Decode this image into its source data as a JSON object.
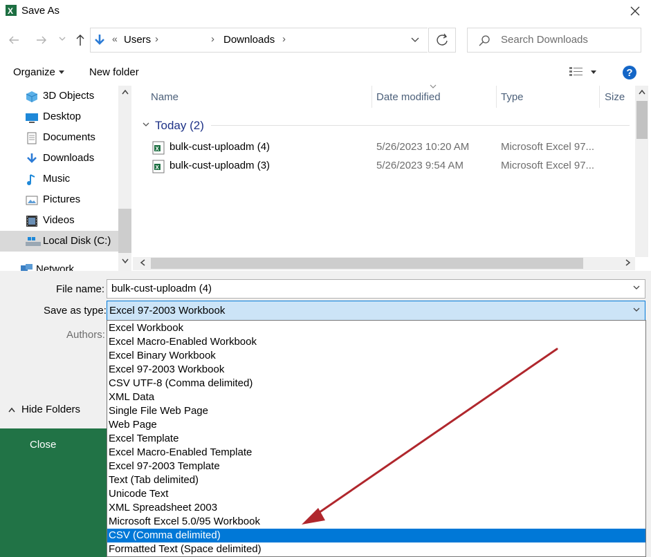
{
  "window": {
    "title": "Save As",
    "app_icon": "excel-icon"
  },
  "address": {
    "overflow": "«",
    "crumbs": [
      "Users",
      "Downloads"
    ],
    "search_placeholder": "Search Downloads"
  },
  "toolbar": {
    "organize": "Organize",
    "new_folder": "New folder",
    "help": "?"
  },
  "nav": {
    "items": [
      {
        "label": "3D Objects",
        "icon": "cube-icon"
      },
      {
        "label": "Desktop",
        "icon": "desktop-icon"
      },
      {
        "label": "Documents",
        "icon": "documents-icon"
      },
      {
        "label": "Downloads",
        "icon": "download-icon"
      },
      {
        "label": "Music",
        "icon": "music-icon"
      },
      {
        "label": "Pictures",
        "icon": "pictures-icon"
      },
      {
        "label": "Videos",
        "icon": "videos-icon"
      },
      {
        "label": "Local Disk (C:)",
        "icon": "drive-icon"
      },
      {
        "label": "Network",
        "icon": "network-icon"
      }
    ],
    "selected": "Local Disk (C:)"
  },
  "files": {
    "columns": [
      "Name",
      "Date modified",
      "Type",
      "Size"
    ],
    "group": "Today (2)",
    "rows": [
      {
        "name": "bulk-cust-uploadm (4)",
        "date": "5/26/2023 10:20 AM",
        "type": "Microsoft Excel 97..."
      },
      {
        "name": "bulk-cust-uploadm (3)",
        "date": "5/26/2023 9:54 AM",
        "type": "Microsoft Excel 97..."
      }
    ]
  },
  "form": {
    "file_name_label": "File name:",
    "file_name_value": "bulk-cust-uploadm (4)",
    "save_type_label": "Save as type:",
    "save_type_value": "Excel 97-2003 Workbook",
    "authors_label": "Authors:",
    "hide_folders": "Hide Folders",
    "close": "Close"
  },
  "type_options": [
    "Excel Workbook",
    "Excel Macro-Enabled Workbook",
    "Excel Binary Workbook",
    "Excel 97-2003 Workbook",
    "CSV UTF-8 (Comma delimited)",
    "XML Data",
    "Single File Web Page",
    "Web Page",
    "Excel Template",
    "Excel Macro-Enabled Template",
    "Excel 97-2003 Template",
    "Text (Tab delimited)",
    "Unicode Text",
    "XML Spreadsheet 2003",
    "Microsoft Excel 5.0/95 Workbook",
    "CSV (Comma delimited)",
    "Formatted Text (Space delimited)"
  ],
  "highlighted_option": "CSV (Comma delimited)",
  "colors": {
    "accent": "#0078d7",
    "excel_green": "#217346",
    "annotation_arrow": "#b0272d"
  }
}
